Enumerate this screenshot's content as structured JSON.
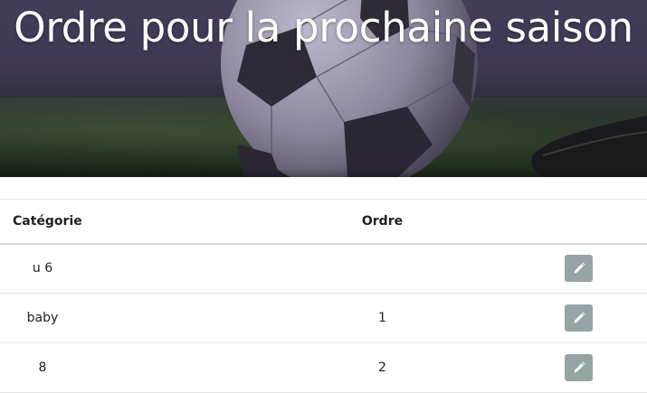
{
  "hero": {
    "title": "Ordre pour la prochaine saison"
  },
  "table": {
    "headers": {
      "category": "Catégorie",
      "order": "Ordre",
      "action": ""
    },
    "rows": [
      {
        "category": "u 6",
        "order": "",
        "action_icon": "pencil-icon"
      },
      {
        "category": "baby",
        "order": "1",
        "action_icon": "pencil-icon"
      },
      {
        "category": "8",
        "order": "2",
        "action_icon": "pencil-icon"
      }
    ]
  },
  "colors": {
    "edit_button": "#95a5a6",
    "title_text": "#ffffff",
    "hero_tint": "#463c5a"
  }
}
